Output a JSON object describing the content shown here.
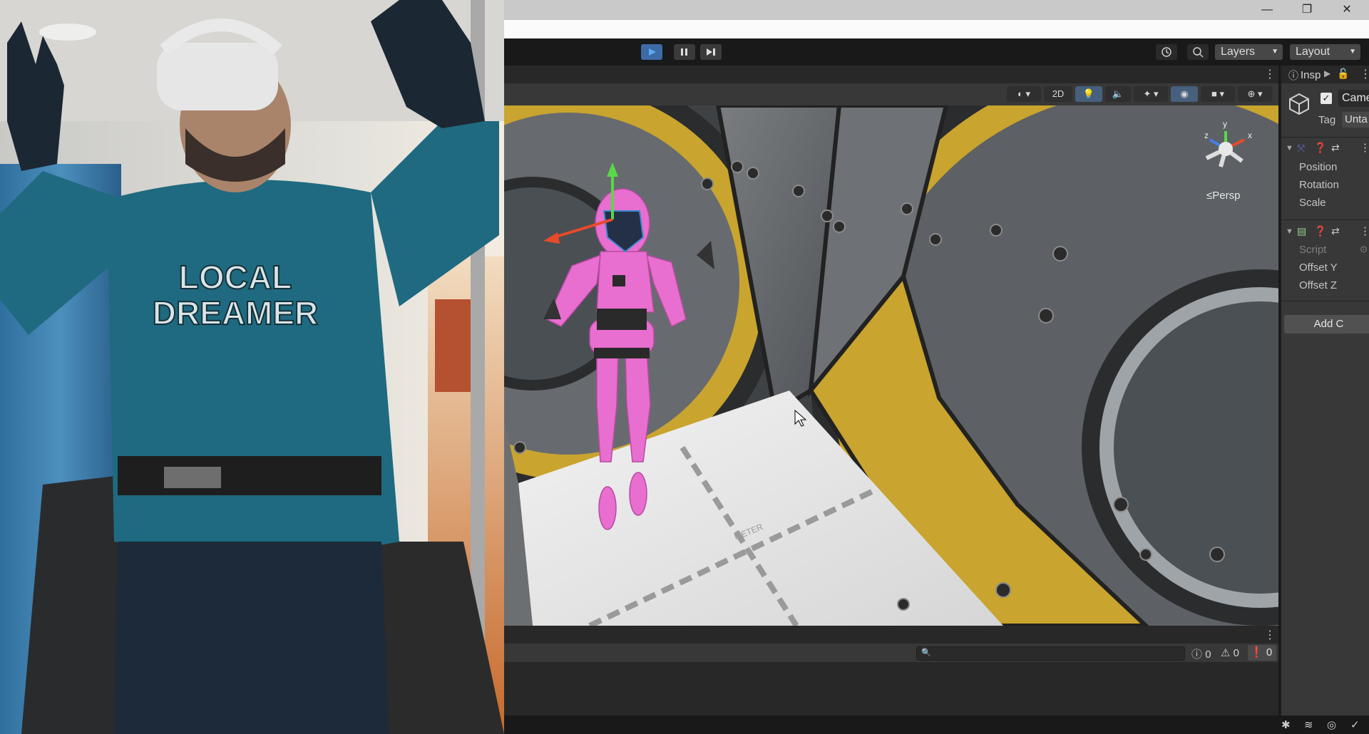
{
  "window": {
    "minimize": "—",
    "restore": "❐",
    "close": "✕"
  },
  "toolbar": {
    "play_icon": "play-icon",
    "pause_icon": "pause-icon",
    "step_icon": "step-icon",
    "history_icon": "history-icon",
    "search_icon": "search-icon",
    "layers_label": "Layers",
    "layout_label": "Layout"
  },
  "scene_toolbar": {
    "mode_2d": "2D"
  },
  "gizmo": {
    "y": "y",
    "x": "x",
    "z": "z",
    "persp": "≤Persp"
  },
  "scene": {
    "floor_text": "METER"
  },
  "webcam": {
    "shirt_line1": "LOCAL",
    "shirt_line2": "DREAMER"
  },
  "inspector": {
    "tab_label": "Insp",
    "object_name": "Came",
    "tag_label": "Tag",
    "tag_value": "Unta",
    "transform": {
      "position": "Position",
      "rotation": "Rotation",
      "scale": "Scale"
    },
    "script": {
      "script": "Script",
      "offset_y": "Offset Y",
      "offset_z": "Offset Z"
    },
    "add_component": "Add C"
  },
  "console": {
    "search_placeholder": "",
    "info_count": "0",
    "warning_count": "0",
    "error_count": "0"
  },
  "colors": {
    "accent": "#3d6ba6",
    "robot_pink": "#e86fcf",
    "gold": "#c9a42e"
  }
}
